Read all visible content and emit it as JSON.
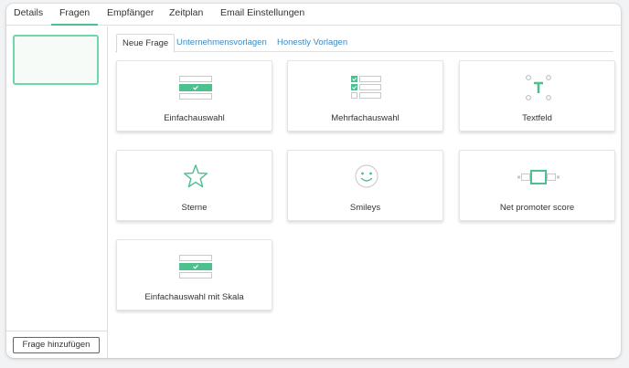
{
  "top_tabs": [
    {
      "label": "Details"
    },
    {
      "label": "Fragen",
      "active": true
    },
    {
      "label": "Empfänger"
    },
    {
      "label": "Zeitplan"
    },
    {
      "label": "Email Einstellungen"
    }
  ],
  "left_panel": {
    "add_button_label": "Frage hinzufügen"
  },
  "sub_tabs": [
    {
      "label": "Neue Frage",
      "active": true
    },
    {
      "label": "Unternehmensvorlagen"
    },
    {
      "label": "Honestly Vorlagen"
    }
  ],
  "question_types": [
    {
      "label": "Einfachauswahl",
      "icon": "single-choice-icon"
    },
    {
      "label": "Mehrfachauswahl",
      "icon": "multiple-choice-icon"
    },
    {
      "label": "Textfeld",
      "icon": "text-field-icon"
    },
    {
      "label": "Sterne",
      "icon": "star-icon"
    },
    {
      "label": "Smileys",
      "icon": "smiley-icon"
    },
    {
      "label": "Net promoter score",
      "icon": "nps-icon"
    },
    {
      "label": "Einfachauswahl mit Skala",
      "icon": "single-choice-scale-icon"
    }
  ],
  "colors": {
    "accent": "#4cc08e",
    "link": "#3b8ac4",
    "border": "#dedede"
  }
}
